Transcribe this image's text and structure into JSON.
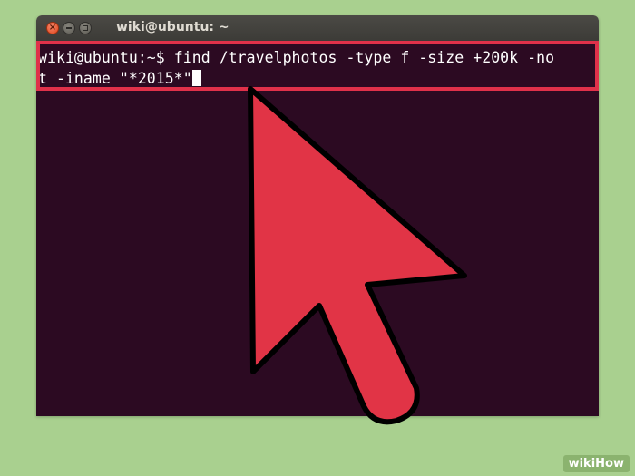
{
  "window": {
    "title": "wiki@ubuntu: ~"
  },
  "terminal": {
    "line1": "wiki@ubuntu:~$ find /travelphotos -type f -size +200k -no",
    "line2": "t -iname \"*2015*\""
  },
  "colors": {
    "background": "#a9d08f",
    "terminal_bg": "#2c0a22",
    "highlight": "#e0314a",
    "arrow_fill": "#e13446",
    "arrow_stroke": "#000000"
  },
  "icons": {
    "close": "close-icon",
    "minimize": "minimize-icon",
    "maximize": "maximize-icon",
    "pointer": "mouse-pointer-icon"
  },
  "watermark": {
    "part1": "wiki",
    "part2": "How"
  }
}
